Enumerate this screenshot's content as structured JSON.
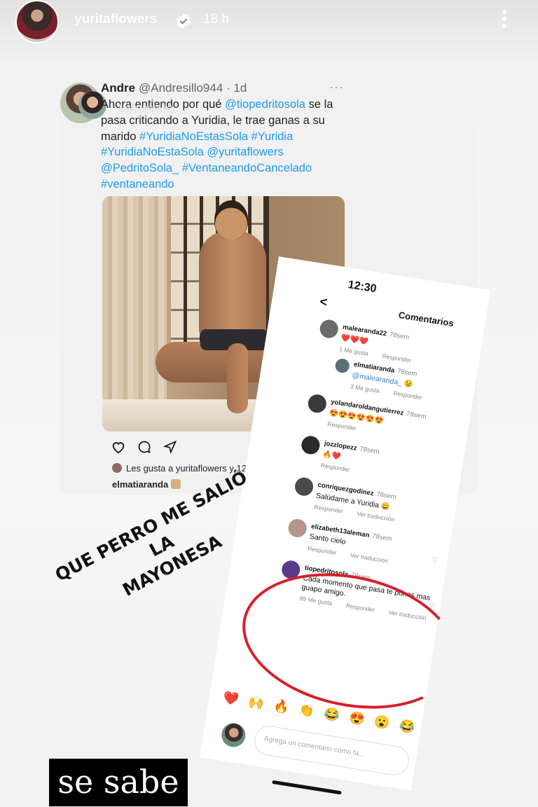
{
  "header": {
    "username": "yuritaflowers",
    "time": "18 h",
    "verified_icon": "verified-badge-icon",
    "more_icon": "more-vertical-icon"
  },
  "tweet": {
    "name": "Andre",
    "handle_time": "@Andresillo944 · 1d",
    "overlay_name": "fatimachida",
    "text_plain_1": "Ahora entiendo por qué ",
    "mention_1": "@tiopedritosola",
    "text_plain_2": " se la pasa criticando a Yuridia, le trae ganas a su marido ",
    "tags_1": "#YuridiaNoEstasSola #Yuridia #YuridiaNoEstaSola @yuritaflowers @PedritoSola_ #VentaneandoCancelado #ventaneando",
    "likes": "Les gusta a yuritaflowers y 12,175 más",
    "caption_user": "elmatiaranda"
  },
  "comments_screen": {
    "time": "12:30",
    "title": "Comentarios",
    "comments": [
      {
        "user": "malearanda22",
        "age": "78sem",
        "body": "❤️❤️❤️",
        "likes": "1 Me gusta",
        "reply": "Responder"
      },
      {
        "user": "elmatiaranda",
        "age": "78sem",
        "body": "@malearanda_ 😉",
        "likes": "3 Me gusta",
        "reply": "Responder"
      },
      {
        "user": "yolandaroldangutierrez",
        "age": "78sem",
        "body": "😍😍😍😍😍😍",
        "reply": "Responder"
      },
      {
        "user": "jozzlopezz",
        "age": "78sem",
        "body": "🔥❤️",
        "reply": "Responder"
      },
      {
        "user": "conriquezgodinez",
        "age": "78sem",
        "body": "Salúdame a Yuridia 😄",
        "reply": "Responder",
        "translate": "Ver traducción"
      },
      {
        "user": "elizabeth13aleman",
        "age": "78sem",
        "body": "Santo cielo",
        "reply": "Responder",
        "translate": "Ver traducción"
      },
      {
        "user": "tiopedritosola",
        "age": "78sem",
        "body_1": "Cada momento que pasa te pones mas",
        "body_2": "guapo amigo.",
        "likes": "89 Me gusta",
        "reply": "Responder",
        "translate": "Ver traducción"
      }
    ],
    "reactions": "❤️🙌🔥👏😂😍😮😂",
    "placeholder": "Agrega un comentario como fa..."
  },
  "overlay": {
    "handwritten_line1": "QUE PERRO ME SALIÓ LA",
    "handwritten_line2": "MAYONESA",
    "sticker": "se sabe"
  },
  "colors": {
    "link": "#1d9bf0",
    "red_circle": "#d81e2a",
    "heart": "#e0245e"
  }
}
